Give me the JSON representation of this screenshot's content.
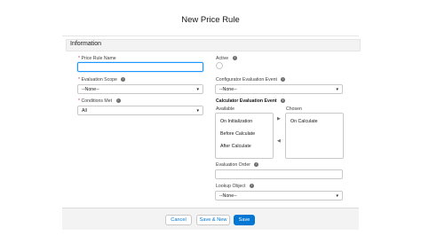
{
  "modal": {
    "title": "New Price Rule"
  },
  "section": {
    "title": "Information"
  },
  "fields": {
    "price_rule_name": {
      "label": "Price Rule Name",
      "value": ""
    },
    "evaluation_scope": {
      "label": "Evaluation Scope",
      "value": "--None--"
    },
    "conditions_met": {
      "label": "Conditions Met",
      "value": "All"
    },
    "active": {
      "label": "Active"
    },
    "configurator_event": {
      "label": "Configurator Evaluation Event",
      "value": "--None--"
    },
    "calculator_event": {
      "label": "Calculator Evaluation Event",
      "available_label": "Available",
      "chosen_label": "Chosen",
      "available": [
        "On Initialization",
        "Before Calculate",
        "After Calculate"
      ],
      "chosen": [
        "On Calculate"
      ]
    },
    "evaluation_order": {
      "label": "Evaluation Order",
      "value": ""
    },
    "lookup_object": {
      "label": "Lookup Object",
      "value": "--None--"
    }
  },
  "required_marker": "*",
  "icons": {
    "info": "info-icon",
    "caret": "chevron-down-icon",
    "move_right": "arrow-right-icon",
    "move_left": "arrow-left-icon"
  },
  "footer": {
    "cancel": "Cancel",
    "save_new": "Save & New",
    "save": "Save"
  },
  "colors": {
    "brand": "#0176d3",
    "focus": "#1b96ff",
    "required": "#c23934"
  }
}
